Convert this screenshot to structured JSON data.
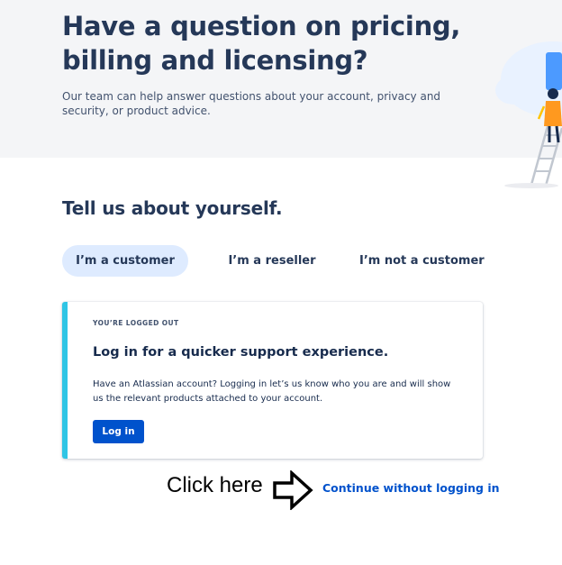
{
  "hero": {
    "title_line1": "Have a question on pricing,",
    "title_line2": "billing and licensing?",
    "subtitle": "Our team can help answer questions about your account, privacy and security, or product advice."
  },
  "section": {
    "title": "Tell us about yourself."
  },
  "tabs": [
    {
      "label": "I’m a customer",
      "active": true
    },
    {
      "label": "I’m a reseller",
      "active": false
    },
    {
      "label": "I’m not a customer",
      "active": false
    }
  ],
  "login_card": {
    "eyebrow": "YOU’RE LOGGED OUT",
    "title": "Log in for a quicker support experience.",
    "body": "Have an Atlassian account? Logging in let’s us know who you are and will show us the relevant products attached to your account.",
    "button_label": "Log in"
  },
  "annotation": {
    "label": "Click here"
  },
  "continue_link": "Continue without logging in",
  "colors": {
    "hero_bg": "#F4F5F7",
    "heading": "#253858",
    "accent_bar": "#2FC5E5",
    "primary": "#0052CC",
    "active_tab_bg": "#DEEBFF"
  }
}
